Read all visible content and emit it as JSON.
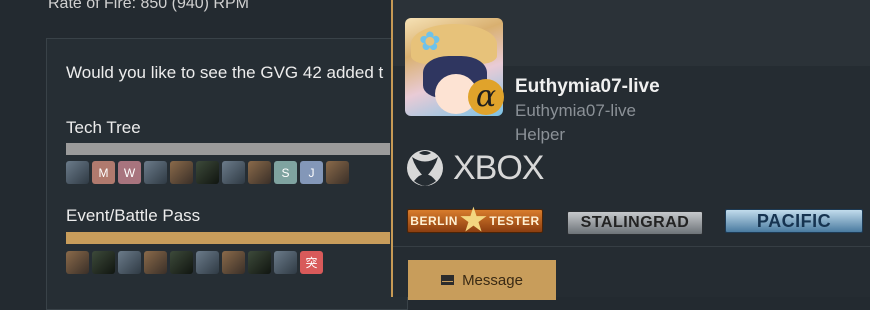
{
  "thread": {
    "stat_line": "Rate of Fire: 850 (940) RPM",
    "poll": {
      "question": "Would you like to see the GVG 42 added t",
      "options": [
        {
          "label": "Tech Tree",
          "fill_fraction": 1.0,
          "fill_color": "#9b9b9b",
          "voters": [
            "avatar",
            "M",
            "W",
            "avatar",
            "avatar",
            "avatar",
            "avatar",
            "avatar",
            "S",
            "J",
            "avatar"
          ]
        },
        {
          "label": "Event/Battle Pass",
          "fill_fraction": 1.0,
          "fill_color": "#c89d5b",
          "voters": [
            "avatar",
            "avatar",
            "avatar",
            "avatar",
            "avatar",
            "avatar",
            "avatar",
            "avatar",
            "avatar",
            "突"
          ]
        }
      ]
    }
  },
  "member_tooltip": {
    "username": "Euthymia07-live",
    "user_title": "Euthymia07-live",
    "user_role": "Helper",
    "role_badge_glyph": "α",
    "platform": "XBOX",
    "event_badges": [
      "BERLIN",
      "TESTER",
      "STALINGRAD",
      "PACIFIC"
    ],
    "message_label": "Message",
    "accent_color": "#c89d5b"
  }
}
